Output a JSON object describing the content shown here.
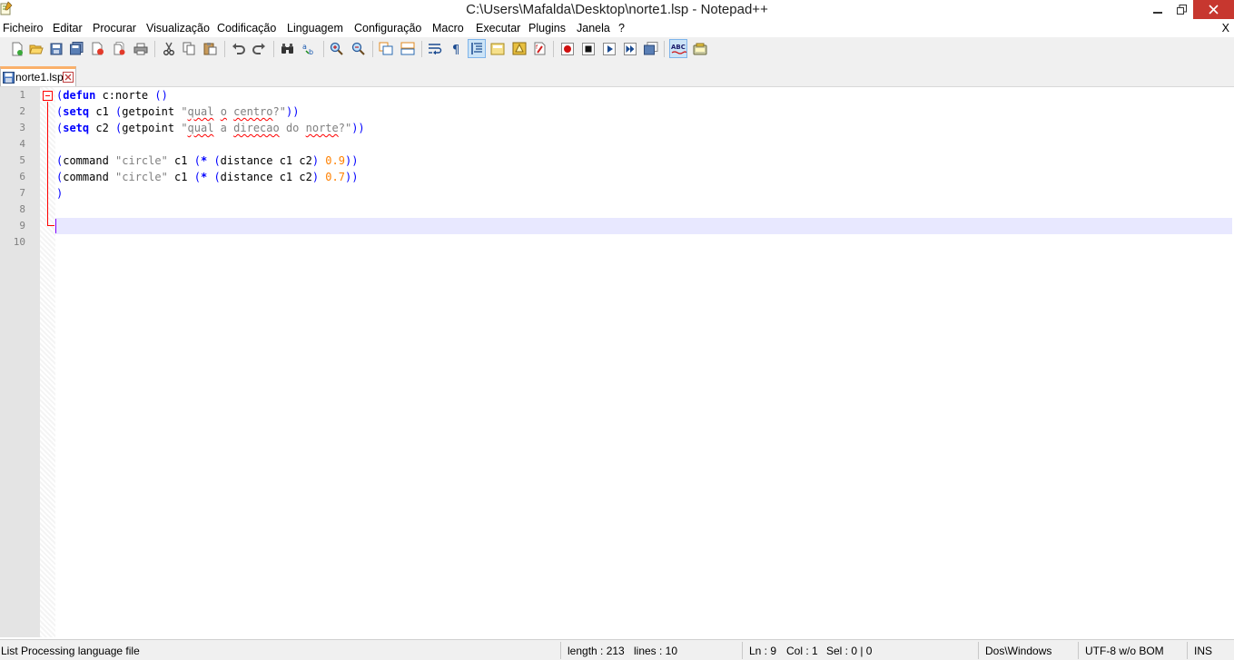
{
  "window": {
    "title": "C:\\Users\\Mafalda\\Desktop\\norte1.lsp - Notepad++"
  },
  "menu": {
    "items": [
      "Ficheiro",
      "Editar",
      "Procurar",
      "Visualização",
      "Codificação",
      "Linguagem",
      "Configuração",
      "Macro",
      "Executar",
      "Plugins",
      "Janela",
      "?"
    ],
    "close_doc": "X"
  },
  "toolbar": {
    "buttons": [
      "new-file-icon",
      "open-file-icon",
      "save-icon",
      "save-all-icon",
      "close-icon",
      "close-all-icon",
      "print-icon",
      "cut-icon",
      "copy-icon",
      "paste-icon",
      "undo-icon",
      "redo-icon",
      "find-icon",
      "replace-icon",
      "zoom-in-icon",
      "zoom-out-icon",
      "sync-vertical-icon",
      "sync-horizontal-icon",
      "word-wrap-icon",
      "show-all-chars-icon",
      "indent-guide-icon",
      "user-lang-icon",
      "doc-map-icon",
      "function-list-icon",
      "record-macro-icon",
      "stop-macro-icon",
      "play-macro-icon",
      "run-macro-multiple-icon",
      "save-macro-icon",
      "spell-check-icon",
      "plugin-icon"
    ]
  },
  "tabs": [
    {
      "label": "norte1.lsp",
      "close": "✕"
    }
  ],
  "editor": {
    "line_numbers": [
      "1",
      "2",
      "3",
      "4",
      "5",
      "6",
      "7",
      "8",
      "9",
      "10"
    ]
  },
  "status": {
    "language": "List Processing language file",
    "length": "length : 213",
    "lines": "lines : 10",
    "ln": "Ln : 9",
    "col": "Col : 1",
    "sel": "Sel : 0 | 0",
    "eol": "Dos\\Windows",
    "encoding": "UTF-8 w/o BOM",
    "mode": "INS"
  },
  "colors": {
    "keyword": "#0000ff",
    "string": "#808080",
    "number": "#ff8000",
    "caret_line": "#e8e8ff",
    "fold_marker": "#ff0000"
  }
}
